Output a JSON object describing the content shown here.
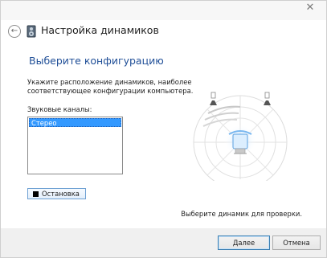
{
  "window": {
    "title": "Настройка динамиков",
    "close_glyph": "✕"
  },
  "nav": {
    "back_glyph": "←"
  },
  "page": {
    "heading": "Выберите конфигурацию",
    "instructions": "Укажите расположение динамиков, наиболее соответствующее конфигурации компьютера.",
    "channels_label": "Звуковые каналы:",
    "channels": [
      "Стерео"
    ],
    "selected_channel": "Стерео",
    "stop_label": "Остановка",
    "hint": "Выберите динамик для проверки."
  },
  "buttons": {
    "next": "Далее",
    "cancel": "Отмена"
  },
  "colors": {
    "heading": "#1f4e97",
    "selection": "#3399ff",
    "diagram_lines": "#d0d0d0",
    "diagram_accent": "#7ab8f0"
  },
  "icons": {
    "back": "back-arrow-icon",
    "app": "speaker-icon",
    "close": "close-icon",
    "stop": "stop-icon"
  }
}
